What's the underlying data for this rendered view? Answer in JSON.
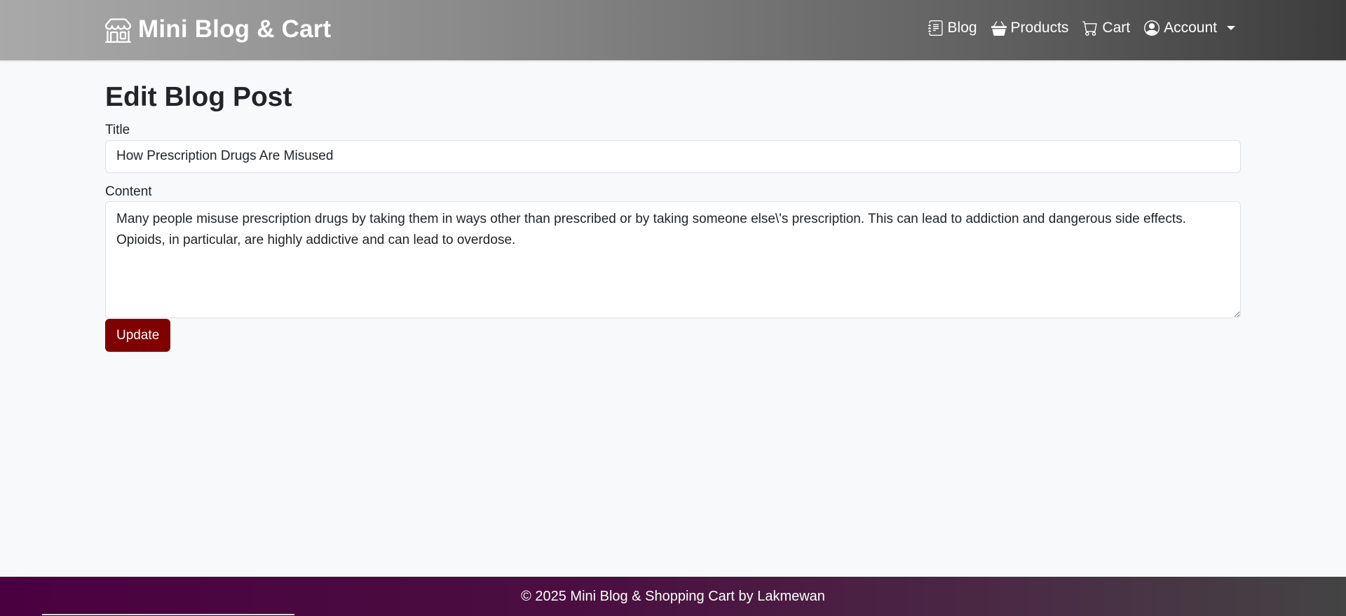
{
  "navbar": {
    "brand_icon": "shop-icon",
    "brand_title": "Mini Blog & Cart",
    "links": [
      {
        "label": "Blog",
        "icon": "journal-icon"
      },
      {
        "label": "Products",
        "icon": "basket-icon"
      },
      {
        "label": "Cart",
        "icon": "cart-icon"
      },
      {
        "label": "Account",
        "icon": "person-circle-icon"
      }
    ]
  },
  "form": {
    "page_title": "Edit Blog Post",
    "title_label": "Title",
    "title_value": "How Prescription Drugs Are Misused",
    "content_label": "Content",
    "content_value": "Many people misuse prescription drugs by taking them in ways other than prescribed or by taking someone else\\'s prescription. This can lead to addiction and dangerous side effects. Opioids, in particular, are highly addictive and can lead to overdose.",
    "submit_label": "Update"
  },
  "footer": {
    "text": "© 2025 Mini Blog & Shopping Cart by Lakmewan"
  },
  "colors": {
    "accent_button": "#800000",
    "page_background": "#f8f9fa",
    "footer_start": "#4a0040"
  }
}
